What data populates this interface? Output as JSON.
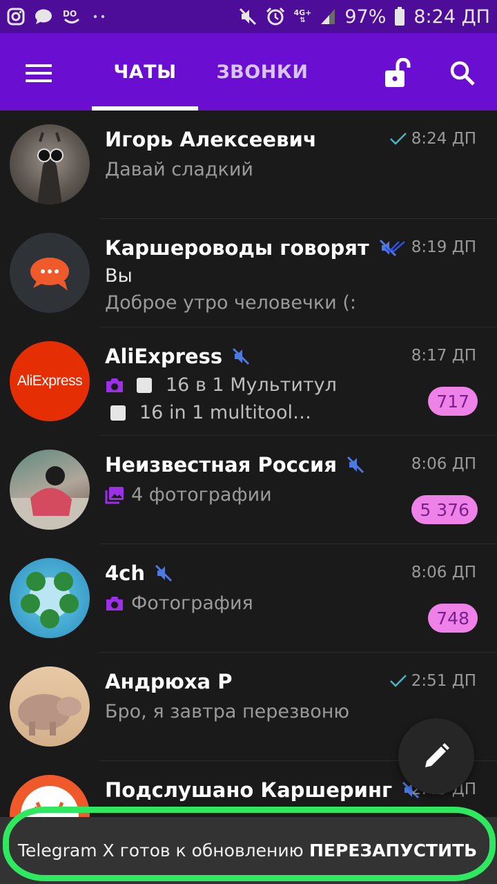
{
  "status_bar": {
    "battery": "97%",
    "time": "8:24 ДП",
    "network": "4G+",
    "icons": [
      "instagram-icon",
      "message-icon",
      "app-icon",
      "dots-icon",
      "mute-icon",
      "alarm-icon",
      "signal-icon",
      "battery-icon"
    ]
  },
  "app_bar": {
    "tab_chats": "ЧАТЫ",
    "tab_calls": "ЗВОНКИ",
    "icons": [
      "menu-icon",
      "lock-open-icon",
      "search-icon"
    ]
  },
  "chats": [
    {
      "name": "Игорь Алексеевич",
      "time": "8:24 ДП",
      "line1": "Давай сладкий",
      "status": "read-single"
    },
    {
      "name": "Каршероводы говорят",
      "time": "8:19 ДП",
      "sender": "Вы",
      "line1": "Доброе утро человечки (:",
      "muted": true,
      "status": "read-double"
    },
    {
      "name": "AliExpress",
      "time": "8:17 ДП",
      "line1": "16 в 1 Мультитул",
      "line2": "16 in 1 multitool…",
      "badge": "717",
      "muted": true,
      "avatar_text": "AliExpress"
    },
    {
      "name": "Неизвестная Россия",
      "time": "8:06 ДП",
      "line1": "4 фотографии",
      "badge": "5 376",
      "muted": true
    },
    {
      "name": "4ch",
      "time": "8:06 ДП",
      "line1": "Фотография",
      "badge": "748",
      "muted": true
    },
    {
      "name": "Андрюха Р",
      "time": "2:51 ДП",
      "line1": "Бро, я завтра перезвоню",
      "status": "read-single"
    },
    {
      "name": "Подслушано Каршеринг",
      "time": "2:43 ДП",
      "muted": true
    }
  ],
  "snackbar": {
    "message": "Telegram X готов к обновлению",
    "action": "ПЕРЕЗАПУСТИТЬ"
  },
  "colors": {
    "status_bar": "#4e0d99",
    "app_bar": "#6a0fd1",
    "background": "#1a1a1a",
    "badge": "#ee82e8",
    "accent": "#8a2be2",
    "highlight": "#2ee85f"
  }
}
